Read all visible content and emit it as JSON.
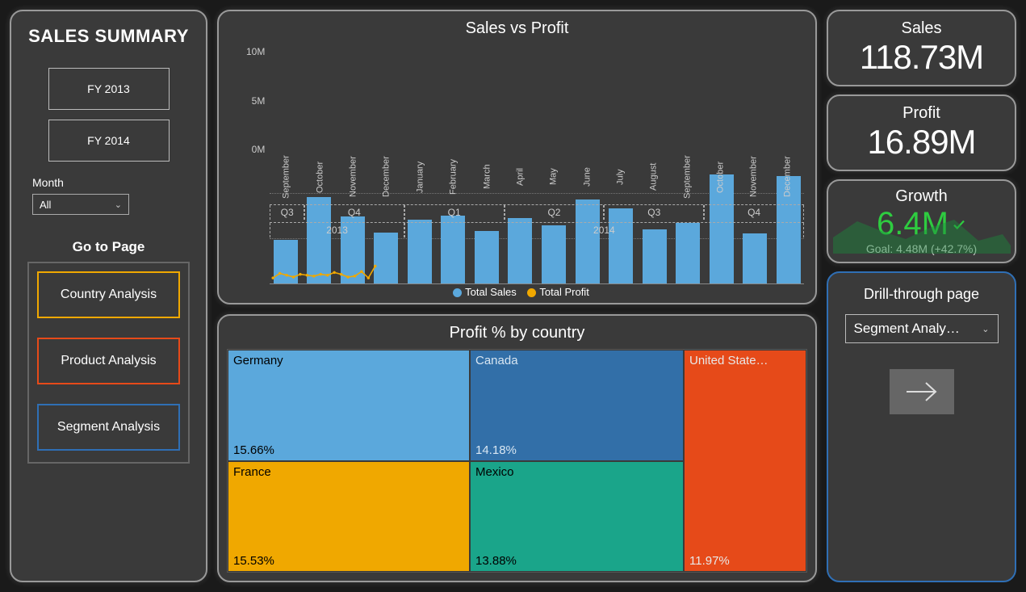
{
  "sidebar": {
    "title": "SALES SUMMARY",
    "fy_buttons": [
      "FY 2013",
      "FY 2014"
    ],
    "month_label": "Month",
    "month_value": "All",
    "goto_label": "Go to Page",
    "nav": [
      {
        "label": "Country Analysis",
        "color": "yellow"
      },
      {
        "label": "Product Analysis",
        "color": "orange"
      },
      {
        "label": "Segment Analysis",
        "color": "blue"
      }
    ]
  },
  "charts": {
    "bar_title": "Sales vs Profit",
    "legend": {
      "sales": "Total Sales",
      "profit": "Total Profit"
    },
    "y_ticks": [
      "10M",
      "5M",
      "0M"
    ],
    "treemap_title": "Profit % by country"
  },
  "chart_data": [
    {
      "type": "bar",
      "title": "Sales vs Profit",
      "ylabel": "",
      "y_ticks": [
        0,
        5000000,
        10000000
      ],
      "ylim": [
        0,
        12000000
      ],
      "categories": [
        "September",
        "October",
        "November",
        "December",
        "January",
        "February",
        "March",
        "April",
        "May",
        "June",
        "July",
        "August",
        "September",
        "October",
        "November",
        "December"
      ],
      "quarter_groups": [
        "Q3",
        "Q4",
        "Q4",
        "Q4",
        "Q1",
        "Q1",
        "Q1",
        "Q2",
        "Q2",
        "Q2",
        "Q3",
        "Q3",
        "Q3",
        "Q4",
        "Q4",
        "Q4"
      ],
      "quarter_axis": [
        "Q3",
        "Q4",
        "Q1",
        "Q2",
        "Q3",
        "Q4"
      ],
      "year_groups": {
        "2013": 4,
        "2014": 12
      },
      "series": [
        {
          "name": "Total Sales",
          "type": "bar",
          "color": "#5ba8dc",
          "values": [
            4800000,
            9500000,
            7400000,
            5600000,
            7000000,
            7500000,
            5800000,
            7200000,
            6400000,
            9300000,
            8300000,
            6000000,
            6700000,
            12000000,
            5500000,
            11800000
          ]
        },
        {
          "name": "Total Profit",
          "type": "line",
          "color": "#f0a800",
          "values": [
            700000,
            1200000,
            1000000,
            800000,
            1100000,
            1000000,
            900000,
            1100000,
            1000000,
            1300000,
            1100000,
            800000,
            900000,
            1400000,
            700000,
            2000000
          ]
        }
      ]
    },
    {
      "type": "treemap",
      "title": "Profit % by country",
      "items": [
        {
          "name": "Germany",
          "value_label": "15.66%",
          "value": 15.66,
          "color": "#5ba8dc"
        },
        {
          "name": "France",
          "value_label": "15.53%",
          "value": 15.53,
          "color": "#f0a800"
        },
        {
          "name": "Canada",
          "value_label": "14.18%",
          "value": 14.18,
          "color": "#326fa8"
        },
        {
          "name": "Mexico",
          "value_label": "13.88%",
          "value": 13.88,
          "color": "#1aa58a"
        },
        {
          "name": "United State…",
          "value_label": "11.97%",
          "value": 11.97,
          "color": "#e64a19"
        }
      ]
    }
  ],
  "kpis": {
    "sales": {
      "label": "Sales",
      "value": "118.73M"
    },
    "profit": {
      "label": "Profit",
      "value": "16.89M"
    },
    "growth": {
      "label": "Growth",
      "value": "6.4M",
      "goal": "Goal: 4.48M (+42.7%)"
    }
  },
  "drill": {
    "label": "Drill-through page",
    "selected": "Segment Analy…"
  }
}
